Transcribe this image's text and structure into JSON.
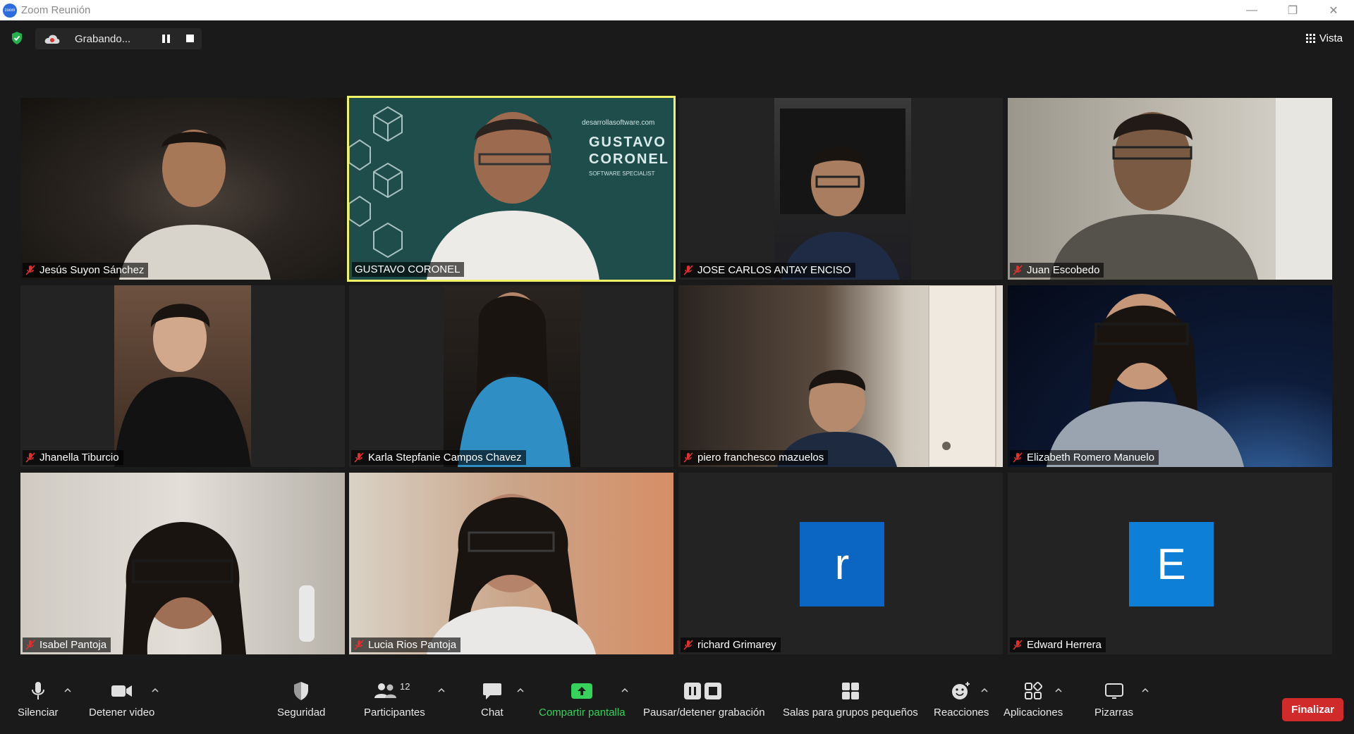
{
  "window": {
    "title": "Zoom Reunión",
    "controls": [
      "minimize",
      "restore",
      "close"
    ]
  },
  "recording": {
    "label": "Grabando..."
  },
  "view": {
    "label": "Vista"
  },
  "participants": [
    {
      "name": "Jesús Suyon Sánchez",
      "muted": true,
      "video": true,
      "active": false
    },
    {
      "name": "GUSTAVO CORONEL",
      "muted": false,
      "video": true,
      "active": true
    },
    {
      "name": "JOSE CARLOS ANTAY ENCISO",
      "muted": true,
      "video": true,
      "active": false
    },
    {
      "name": "Juan Escobedo",
      "muted": true,
      "video": true,
      "active": false
    },
    {
      "name": "Jhanella Tiburcio",
      "muted": true,
      "video": true,
      "active": false
    },
    {
      "name": "Karla Stepfanie Campos Chavez",
      "muted": true,
      "video": true,
      "active": false
    },
    {
      "name": "piero franchesco mazuelos",
      "muted": true,
      "video": true,
      "active": false
    },
    {
      "name": "Elizabeth Romero Manuelo",
      "muted": true,
      "video": true,
      "active": false
    },
    {
      "name": "Isabel Pantoja",
      "muted": true,
      "video": true,
      "active": false
    },
    {
      "name": "Lucia Rios Pantoja",
      "muted": true,
      "video": true,
      "active": false
    },
    {
      "name": "richard Grimarey",
      "muted": true,
      "video": false,
      "avatar_letter": "r",
      "avatar_color": "#0b66c3",
      "active": false
    },
    {
      "name": "Edward Herrera",
      "muted": true,
      "video": false,
      "avatar_letter": "E",
      "avatar_color": "#0e7fd6",
      "active": false
    }
  ],
  "background_brand": {
    "site": "desarrollasoftware.com",
    "line1": "GUSTAVO",
    "line2": "CORONEL",
    "line3": "SOFTWARE SPECIALIST"
  },
  "toolbar": {
    "mute": "Silenciar",
    "video": "Detener video",
    "security": "Seguridad",
    "participants": "Participantes",
    "participants_count": "12",
    "chat": "Chat",
    "share": "Compartir pantalla",
    "record": "Pausar/detener grabación",
    "breakout": "Salas para grupos pequeños",
    "reactions": "Reacciones",
    "apps": "Aplicaciones",
    "whiteboards": "Pizarras",
    "end": "Finalizar"
  },
  "colors": {
    "active_speaker_border": "#f3f36a",
    "share_green": "#35d35b",
    "end_red": "#d12a2a",
    "mute_red": "#e0302f"
  }
}
